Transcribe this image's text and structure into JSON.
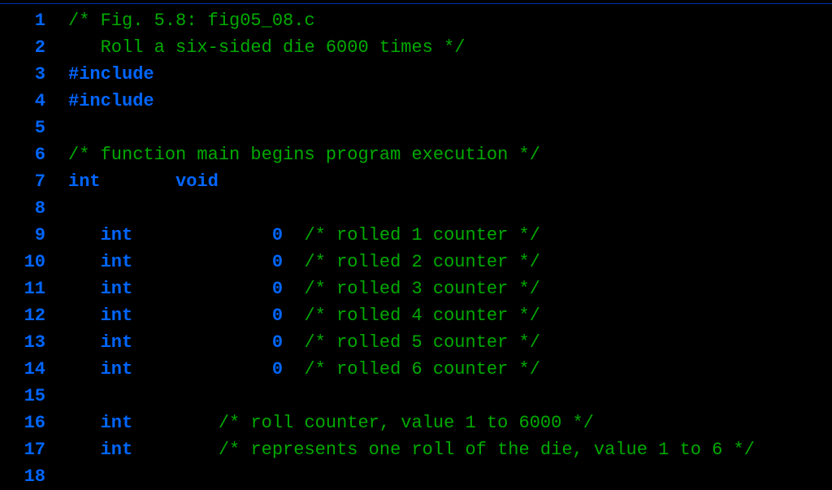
{
  "lines": [
    {
      "num": "1",
      "tokens": [
        {
          "t": "comment",
          "v": "/* Fig. 5.8: fig05_08.c"
        }
      ]
    },
    {
      "num": "2",
      "tokens": [
        {
          "t": "comment",
          "v": "   Roll a six-sided die 6000 times */"
        }
      ]
    },
    {
      "num": "3",
      "tokens": [
        {
          "t": "keyword",
          "v": "#include"
        }
      ]
    },
    {
      "num": "4",
      "tokens": [
        {
          "t": "keyword",
          "v": "#include"
        }
      ]
    },
    {
      "num": "5",
      "tokens": []
    },
    {
      "num": "6",
      "tokens": [
        {
          "t": "comment",
          "v": "/* function main begins program execution */"
        }
      ]
    },
    {
      "num": "7",
      "tokens": [
        {
          "t": "keyword",
          "v": "int"
        },
        {
          "t": "plain",
          "v": "       "
        },
        {
          "t": "keyword",
          "v": "void"
        }
      ]
    },
    {
      "num": "8",
      "tokens": []
    },
    {
      "num": "9",
      "tokens": [
        {
          "t": "plain",
          "v": "   "
        },
        {
          "t": "keyword",
          "v": "int"
        },
        {
          "t": "plain",
          "v": "             "
        },
        {
          "t": "number",
          "v": "0"
        },
        {
          "t": "plain",
          "v": "  "
        },
        {
          "t": "comment",
          "v": "/* rolled 1 counter */"
        }
      ]
    },
    {
      "num": "10",
      "tokens": [
        {
          "t": "plain",
          "v": "   "
        },
        {
          "t": "keyword",
          "v": "int"
        },
        {
          "t": "plain",
          "v": "             "
        },
        {
          "t": "number",
          "v": "0"
        },
        {
          "t": "plain",
          "v": "  "
        },
        {
          "t": "comment",
          "v": "/* rolled 2 counter */"
        }
      ]
    },
    {
      "num": "11",
      "tokens": [
        {
          "t": "plain",
          "v": "   "
        },
        {
          "t": "keyword",
          "v": "int"
        },
        {
          "t": "plain",
          "v": "             "
        },
        {
          "t": "number",
          "v": "0"
        },
        {
          "t": "plain",
          "v": "  "
        },
        {
          "t": "comment",
          "v": "/* rolled 3 counter */"
        }
      ]
    },
    {
      "num": "12",
      "tokens": [
        {
          "t": "plain",
          "v": "   "
        },
        {
          "t": "keyword",
          "v": "int"
        },
        {
          "t": "plain",
          "v": "             "
        },
        {
          "t": "number",
          "v": "0"
        },
        {
          "t": "plain",
          "v": "  "
        },
        {
          "t": "comment",
          "v": "/* rolled 4 counter */"
        }
      ]
    },
    {
      "num": "13",
      "tokens": [
        {
          "t": "plain",
          "v": "   "
        },
        {
          "t": "keyword",
          "v": "int"
        },
        {
          "t": "plain",
          "v": "             "
        },
        {
          "t": "number",
          "v": "0"
        },
        {
          "t": "plain",
          "v": "  "
        },
        {
          "t": "comment",
          "v": "/* rolled 5 counter */"
        }
      ]
    },
    {
      "num": "14",
      "tokens": [
        {
          "t": "plain",
          "v": "   "
        },
        {
          "t": "keyword",
          "v": "int"
        },
        {
          "t": "plain",
          "v": "             "
        },
        {
          "t": "number",
          "v": "0"
        },
        {
          "t": "plain",
          "v": "  "
        },
        {
          "t": "comment",
          "v": "/* rolled 6 counter */"
        }
      ]
    },
    {
      "num": "15",
      "tokens": []
    },
    {
      "num": "16",
      "tokens": [
        {
          "t": "plain",
          "v": "   "
        },
        {
          "t": "keyword",
          "v": "int"
        },
        {
          "t": "plain",
          "v": "        "
        },
        {
          "t": "comment",
          "v": "/* roll counter, value 1 to 6000 */"
        }
      ]
    },
    {
      "num": "17",
      "tokens": [
        {
          "t": "plain",
          "v": "   "
        },
        {
          "t": "keyword",
          "v": "int"
        },
        {
          "t": "plain",
          "v": "        "
        },
        {
          "t": "comment",
          "v": "/* represents one roll of the die, value 1 to 6 */"
        }
      ]
    },
    {
      "num": "18",
      "tokens": []
    }
  ]
}
